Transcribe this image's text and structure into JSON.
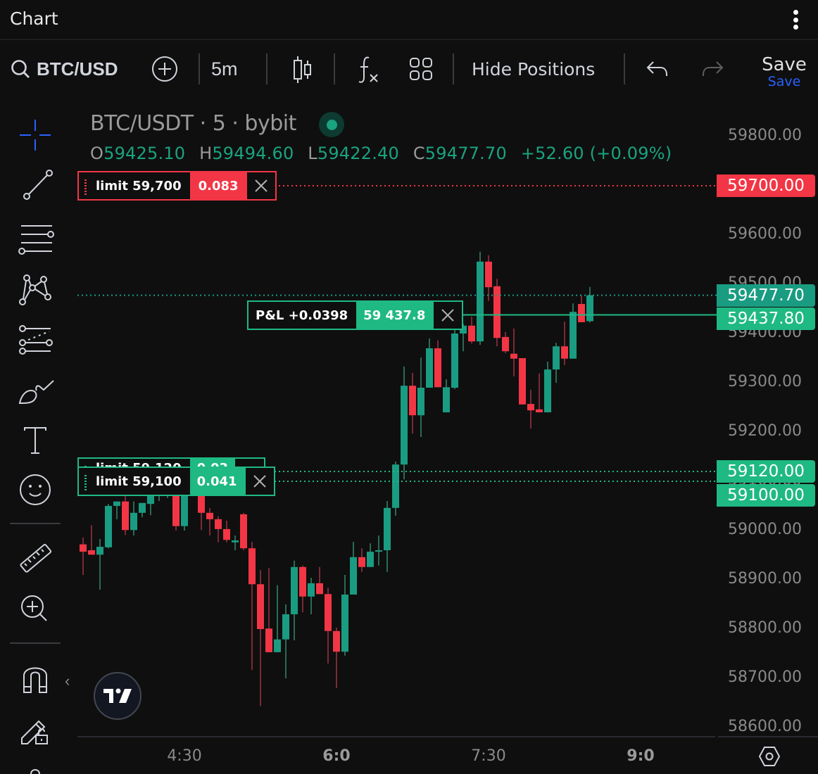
{
  "app": {
    "title": "Chart"
  },
  "toolbar": {
    "symbol": "BTC/USD",
    "timeframe": "5m",
    "hide_positions": "Hide Positions",
    "save_label": "Save",
    "save_sublabel": "Save",
    "icons": [
      "search-icon",
      "add-compare-icon",
      "candles-icon",
      "indicators-icon",
      "layouts-icon",
      "undo-icon",
      "redo-icon"
    ]
  },
  "left_tools": [
    {
      "name": "crosshair-icon",
      "active": true
    },
    {
      "name": "trend-line-icon"
    },
    {
      "name": "fib-retracement-icon"
    },
    {
      "name": "pattern-icon"
    },
    {
      "name": "prediction-icon"
    },
    {
      "name": "brush-icon"
    },
    {
      "name": "text-icon"
    },
    {
      "name": "emoji-icon"
    },
    {
      "name": "ruler-icon"
    },
    {
      "name": "zoom-in-icon"
    },
    {
      "name": "magnet-icon"
    },
    {
      "name": "lock-drawings-icon"
    }
  ],
  "legend": {
    "title": "BTC/USDT · 5 · bybit",
    "o_label": "O",
    "o": "59425.10",
    "h_label": "H",
    "h": "59494.60",
    "l_label": "L",
    "l": "59422.40",
    "c_label": "C",
    "c": "59477.70",
    "change": "+52.60 (+0.09%)"
  },
  "orders": {
    "limit_sell": {
      "label": "limit 59,700",
      "qty": "0.083",
      "price": 59700,
      "axis_label": "59700.00"
    },
    "limit_buy_1": {
      "label": "limit 59,120",
      "qty": "0.03",
      "price": 59120,
      "axis_label": "59120.00"
    },
    "limit_buy_2": {
      "label": "limit 59,100",
      "qty": "0.041",
      "price": 59100,
      "axis_label": "59100.00"
    },
    "position": {
      "label": "P&L +0.0398",
      "price_text": "59 437.8",
      "price": 59437.8,
      "axis_label": "59437.80"
    }
  },
  "last_price": {
    "value": 59477.7,
    "axis_label": "59477.70"
  },
  "colors": {
    "up": "#1a9c82",
    "down": "#f23645",
    "position": "#1fb983",
    "sell_limit": "#f23645",
    "accent": "#2962ff"
  },
  "chart_data": {
    "type": "candlestick",
    "symbol": "BTC/USDT",
    "interval": "5",
    "exchange": "bybit",
    "y_ticks": [
      "59800.00",
      "59700.00",
      "59600.00",
      "59500.00",
      "59400.00",
      "59300.00",
      "59200.00",
      "59100.00",
      "59000.00",
      "58900.00",
      "58800.00",
      "58700.00",
      "58600.00"
    ],
    "ylim": [
      58600,
      59800
    ],
    "x_ticks": [
      {
        "label": "4:30",
        "bold": false,
        "index": 12
      },
      {
        "label": "6:0",
        "bold": true,
        "index": 30
      },
      {
        "label": "7:30",
        "bold": false,
        "index": 48
      },
      {
        "label": "9:0",
        "bold": true,
        "index": 66
      }
    ],
    "candles": [
      [
        58972,
        58986,
        58910,
        58957
      ],
      [
        58960,
        59011,
        58951,
        58951
      ],
      [
        58951,
        58983,
        58880,
        58967
      ],
      [
        58966,
        59054,
        58964,
        59050
      ],
      [
        59050,
        59059,
        59023,
        59059
      ],
      [
        59059,
        59070,
        58991,
        59001
      ],
      [
        59001,
        59059,
        58990,
        59036
      ],
      [
        59036,
        59056,
        59027,
        59056
      ],
      [
        59054,
        59077,
        59031,
        59077
      ],
      [
        59077,
        59085,
        59060,
        59080
      ],
      [
        59080,
        59092,
        59066,
        59086
      ],
      [
        59086,
        59090,
        59000,
        59009
      ],
      [
        59009,
        59084,
        59000,
        59077
      ],
      [
        59077,
        59098,
        59070,
        59088
      ],
      [
        59088,
        59091,
        59001,
        59036
      ],
      [
        59036,
        59046,
        58990,
        59023
      ],
      [
        59023,
        59029,
        58976,
        59003
      ],
      [
        59003,
        59020,
        58976,
        58981
      ],
      [
        58976,
        58990,
        58960,
        58980
      ],
      [
        59033,
        59036,
        58960,
        58964
      ],
      [
        58964,
        58977,
        58717,
        58891
      ],
      [
        58891,
        58920,
        58644,
        58800
      ],
      [
        58801,
        58924,
        58753,
        58753
      ],
      [
        58753,
        58889,
        58753,
        58779
      ],
      [
        58779,
        58850,
        58700,
        58830
      ],
      [
        58830,
        58939,
        58777,
        58926
      ],
      [
        58926,
        58929,
        58834,
        58866
      ],
      [
        58866,
        58904,
        58830,
        58893
      ],
      [
        58893,
        58926,
        58871,
        58871
      ],
      [
        58871,
        58884,
        58730,
        58796
      ],
      [
        58796,
        58803,
        58680,
        58754
      ],
      [
        58754,
        58910,
        58746,
        58870
      ],
      [
        58870,
        58977,
        58870,
        58946
      ],
      [
        58946,
        58964,
        58916,
        58926
      ],
      [
        58926,
        58974,
        58926,
        58957
      ],
      [
        58957,
        58990,
        58929,
        58960
      ],
      [
        58960,
        59060,
        58916,
        59046
      ],
      [
        59046,
        59140,
        59030,
        59134
      ],
      [
        59134,
        59333,
        59104,
        59294
      ],
      [
        59294,
        59320,
        59197,
        59234
      ],
      [
        59234,
        59351,
        59190,
        59290
      ],
      [
        59290,
        59390,
        59290,
        59370
      ],
      [
        59370,
        59386,
        59291,
        59291
      ],
      [
        59240,
        59307,
        59240,
        59291
      ],
      [
        59290,
        59407,
        59287,
        59400
      ],
      [
        59400,
        59420,
        59364,
        59416
      ],
      [
        59416,
        59434,
        59380,
        59384
      ],
      [
        59384,
        59566,
        59377,
        59546
      ],
      [
        59546,
        59559,
        59466,
        59494
      ],
      [
        59496,
        59511,
        59374,
        59391
      ],
      [
        59393,
        59403,
        59360,
        59364
      ],
      [
        59359,
        59410,
        59313,
        59349
      ],
      [
        59350,
        59350,
        59256,
        59256
      ],
      [
        59257,
        59286,
        59207,
        59244
      ],
      [
        59246,
        59319,
        59240,
        59240
      ],
      [
        59240,
        59343,
        59240,
        59327
      ],
      [
        59327,
        59381,
        59300,
        59374
      ],
      [
        59374,
        59424,
        59336,
        59349
      ],
      [
        59349,
        59461,
        59349,
        59444
      ],
      [
        59460,
        59477,
        59423,
        59423
      ],
      [
        59425.1,
        59494.6,
        59422.4,
        59477.7
      ]
    ],
    "candle_fields": [
      "open",
      "high",
      "low",
      "close"
    ]
  }
}
